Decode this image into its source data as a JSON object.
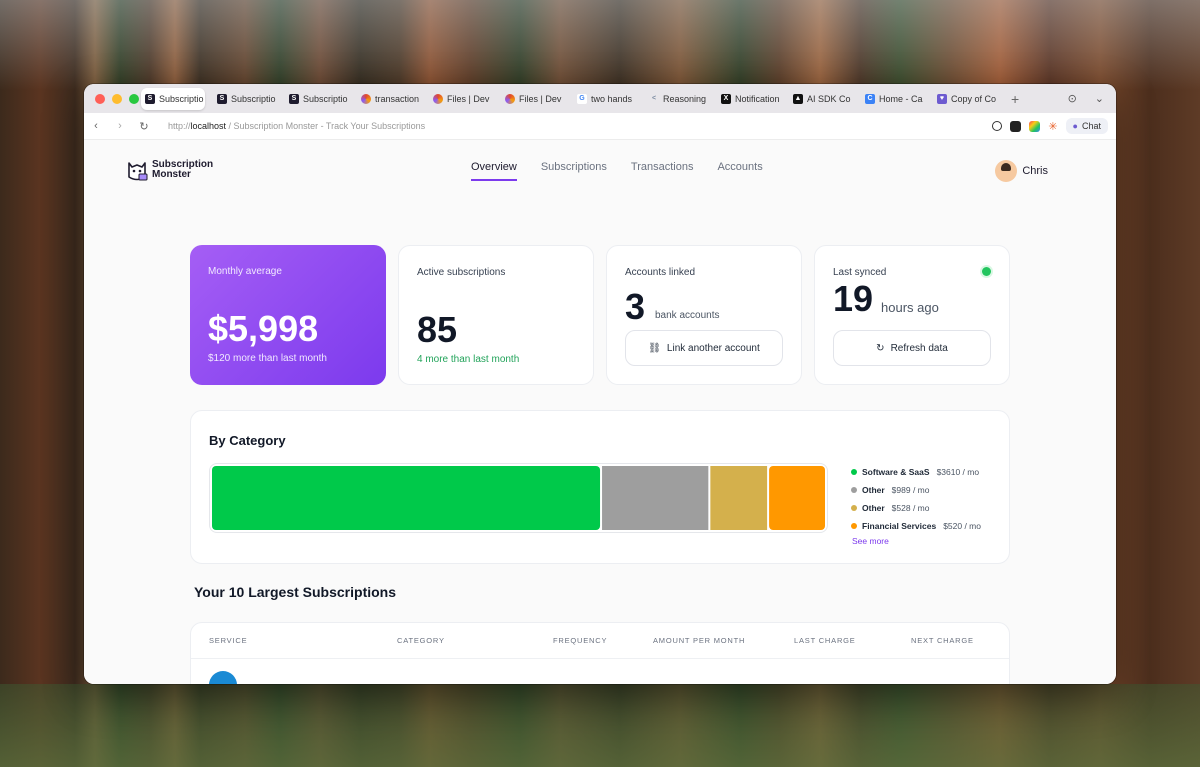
{
  "browser": {
    "tabs": [
      {
        "label": "Subscriptio",
        "icon": "app-icon",
        "color": "#1e1b2e",
        "active": true
      },
      {
        "label": "Subscriptio",
        "icon": "app-icon",
        "color": "#1e1b2e"
      },
      {
        "label": "Subscriptio",
        "icon": "app-icon",
        "color": "#1e1b2e"
      },
      {
        "label": "transaction",
        "icon": "dev-icon",
        "color": "#e0482f"
      },
      {
        "label": "Files | Dev",
        "icon": "dev-icon",
        "color": "#e0482f"
      },
      {
        "label": "Files | Dev",
        "icon": "dev-icon",
        "color": "#e0482f"
      },
      {
        "label": "two hands",
        "icon": "google-icon",
        "color": "#4285f4"
      },
      {
        "label": "Reasoning",
        "icon": "chevron-icon",
        "color": "#7a8aa0"
      },
      {
        "label": "Notification",
        "icon": "x-icon",
        "color": "#111111"
      },
      {
        "label": "AI SDK Co",
        "icon": "triangle-icon",
        "color": "#111111"
      },
      {
        "label": "Home - Ca",
        "icon": "c-icon",
        "color": "#3b82f6"
      },
      {
        "label": "Copy of Co",
        "icon": "heart-icon",
        "color": "#6d5bd0"
      }
    ],
    "url_prefix": "http://",
    "url_host": "localhost",
    "url_rest": " / Subscription Monster - Track Your Subscriptions",
    "chat_label": "Chat"
  },
  "app": {
    "logo_line1": "Subscription",
    "logo_line2": "Monster",
    "nav": [
      "Overview",
      "Subscriptions",
      "Transactions",
      "Accounts"
    ],
    "user_name": "Chris"
  },
  "stats": {
    "monthly": {
      "label": "Monthly average",
      "value": "$5,998",
      "sub": "$120 more than last month"
    },
    "active": {
      "label": "Active subscriptions",
      "value": "85",
      "sub": "4 more than last month"
    },
    "accounts": {
      "label": "Accounts linked",
      "value": "3",
      "unit": "bank accounts",
      "button": "Link another account"
    },
    "synced": {
      "label": "Last synced",
      "value": "19",
      "unit": "hours ago",
      "button": "Refresh data"
    }
  },
  "category": {
    "title": "By Category",
    "see_more": "See more",
    "items": [
      {
        "name": "Software & SaaS",
        "amount": "$3610 / mo",
        "color": "#00c94a"
      },
      {
        "name": "Other",
        "amount": "$989 / mo",
        "color": "#9e9e9e"
      },
      {
        "name": "Other",
        "amount": "$528 / mo",
        "color": "#d4b04c"
      },
      {
        "name": "Financial Services",
        "amount": "$520 / mo",
        "color": "#ff9800"
      }
    ]
  },
  "chart_data": {
    "type": "bar",
    "categories": [
      "Software & SaaS",
      "Other",
      "Other",
      "Financial Services"
    ],
    "values": [
      3610,
      989,
      528,
      520
    ],
    "title": "By Category"
  },
  "largest": {
    "title": "Your 10 Largest Subscriptions",
    "columns": [
      "SERVICE",
      "CATEGORY",
      "FREQUENCY",
      "AMOUNT PER MONTH",
      "LAST CHARGE",
      "NEXT CHARGE"
    ]
  }
}
